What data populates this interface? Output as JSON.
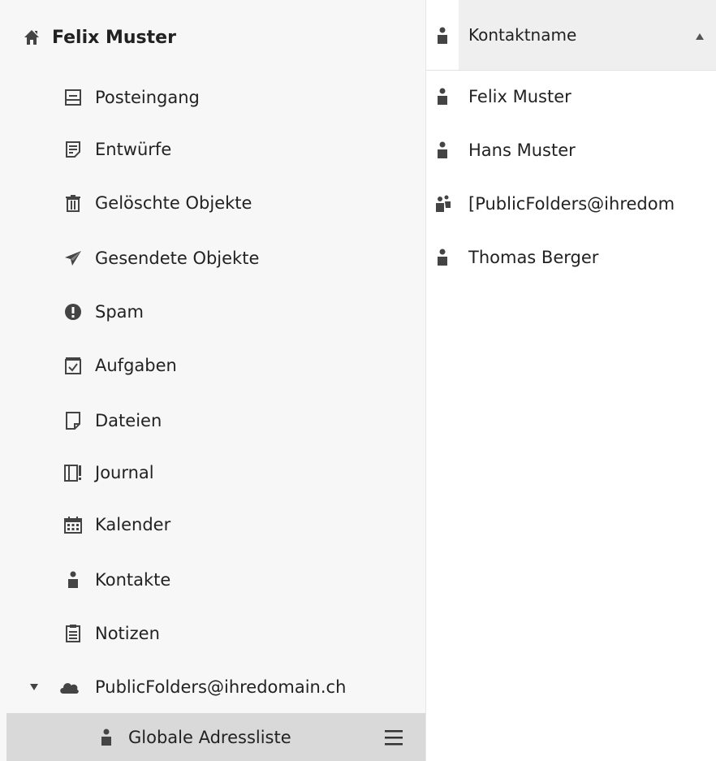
{
  "account": {
    "name": "Felix Muster",
    "icon": "home-icon"
  },
  "folders": [
    {
      "label": "Posteingang",
      "icon": "inbox-icon"
    },
    {
      "label": "Entwürfe",
      "icon": "drafts-icon"
    },
    {
      "label": "Gelöschte Objekte",
      "icon": "trash-icon"
    },
    {
      "label": "Gesendete Objekte",
      "icon": "sent-icon"
    },
    {
      "label": "Spam",
      "icon": "spam-icon"
    },
    {
      "label": "Aufgaben",
      "icon": "tasks-icon"
    },
    {
      "label": "Dateien",
      "icon": "files-icon"
    },
    {
      "label": "Journal",
      "icon": "journal-icon"
    },
    {
      "label": "Kalender",
      "icon": "calendar-icon"
    },
    {
      "label": "Kontakte",
      "icon": "contact-icon"
    },
    {
      "label": "Notizen",
      "icon": "notes-icon"
    }
  ],
  "public_folders": {
    "label": "PublicFolders@ihredomain.ch",
    "icon": "cloud-icon",
    "expanded": true
  },
  "selected_folder": {
    "label": "Globale Adressliste",
    "icon": "contact-icon",
    "menu_icon": "hamburger-icon"
  },
  "list": {
    "column_header": "Kontaktname",
    "sort": "ascending",
    "rows": [
      {
        "name": "Felix Muster",
        "type": "contact"
      },
      {
        "name": "Hans Muster",
        "type": "contact"
      },
      {
        "name": "[PublicFolders@ihredom",
        "type": "group"
      },
      {
        "name": "Thomas Berger",
        "type": "contact"
      }
    ]
  },
  "colors": {
    "sidebar_bg": "#f7f7f7",
    "selected_bg": "#d9d9d9",
    "header_bg": "#efefef",
    "icon": "#444444"
  }
}
